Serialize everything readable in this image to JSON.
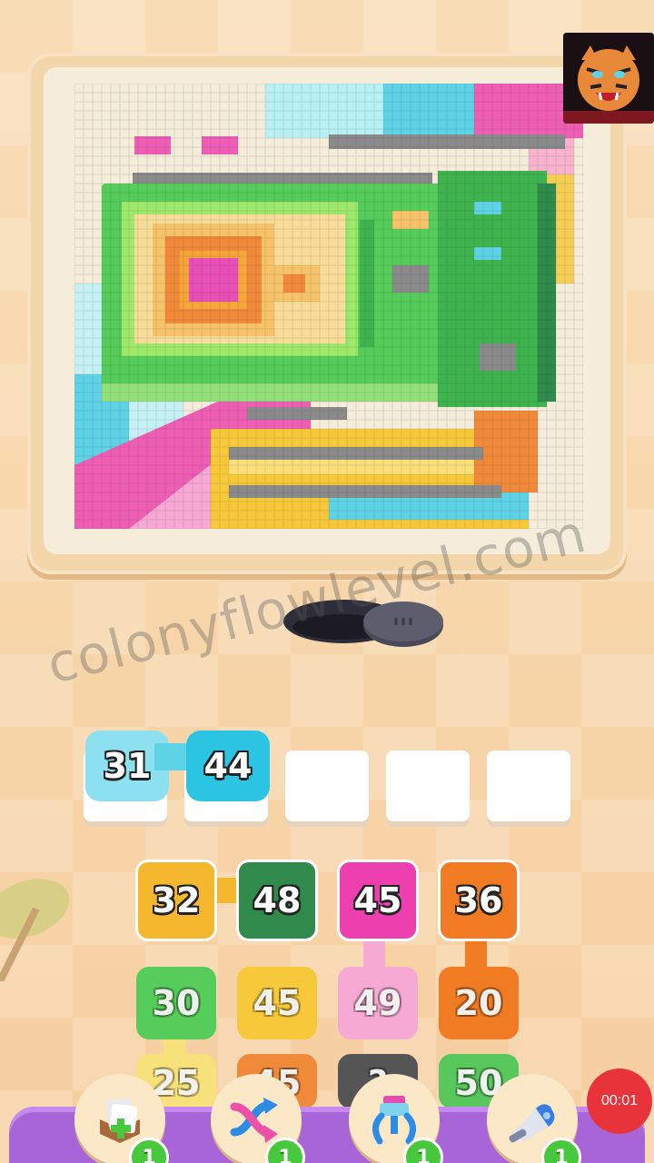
{
  "watermark": "colonyflowlevel.com",
  "timer": {
    "label": "00:01"
  },
  "slots": [
    {
      "value": "31",
      "color": "#8de0f0",
      "state": "filled"
    },
    {
      "value": "44",
      "color": "#2cc4e3",
      "state": "filled"
    },
    {
      "value": "",
      "state": "empty"
    },
    {
      "value": "",
      "state": "empty"
    },
    {
      "value": "",
      "state": "empty"
    }
  ],
  "grid": {
    "row1": [
      {
        "value": "32",
        "color": "#f5b72e"
      },
      {
        "value": "48",
        "color": "#2f8a4c"
      },
      {
        "value": "45",
        "color": "#ee3fae"
      },
      {
        "value": "36",
        "color": "#f07b22"
      }
    ],
    "row2": [
      {
        "value": "30",
        "color": "#56cc5a"
      },
      {
        "value": "45",
        "color": "#f7c93a"
      },
      {
        "value": "49",
        "color": "#f6a9d2"
      },
      {
        "value": "20",
        "color": "#f07b22"
      }
    ],
    "row3": [
      {
        "value": "25",
        "color": "#f8e07a"
      },
      {
        "value": "45",
        "color": "#f08a3a"
      },
      {
        "value": "?",
        "color": "#555555"
      },
      {
        "value": "50",
        "color": "#58c85c"
      }
    ]
  },
  "boosters": [
    {
      "icon": "add-tile-icon",
      "count": "1"
    },
    {
      "icon": "shuffle-icon",
      "count": "1"
    },
    {
      "icon": "magnet-claw-icon",
      "count": "1"
    },
    {
      "icon": "vacuum-icon",
      "count": "1"
    }
  ],
  "colors": {
    "background": "#f8d7ad",
    "board": "#f3d7ab",
    "bottom_bar": "#a765d8",
    "timer": "#e8333a",
    "count_badge": "#48c83c"
  }
}
